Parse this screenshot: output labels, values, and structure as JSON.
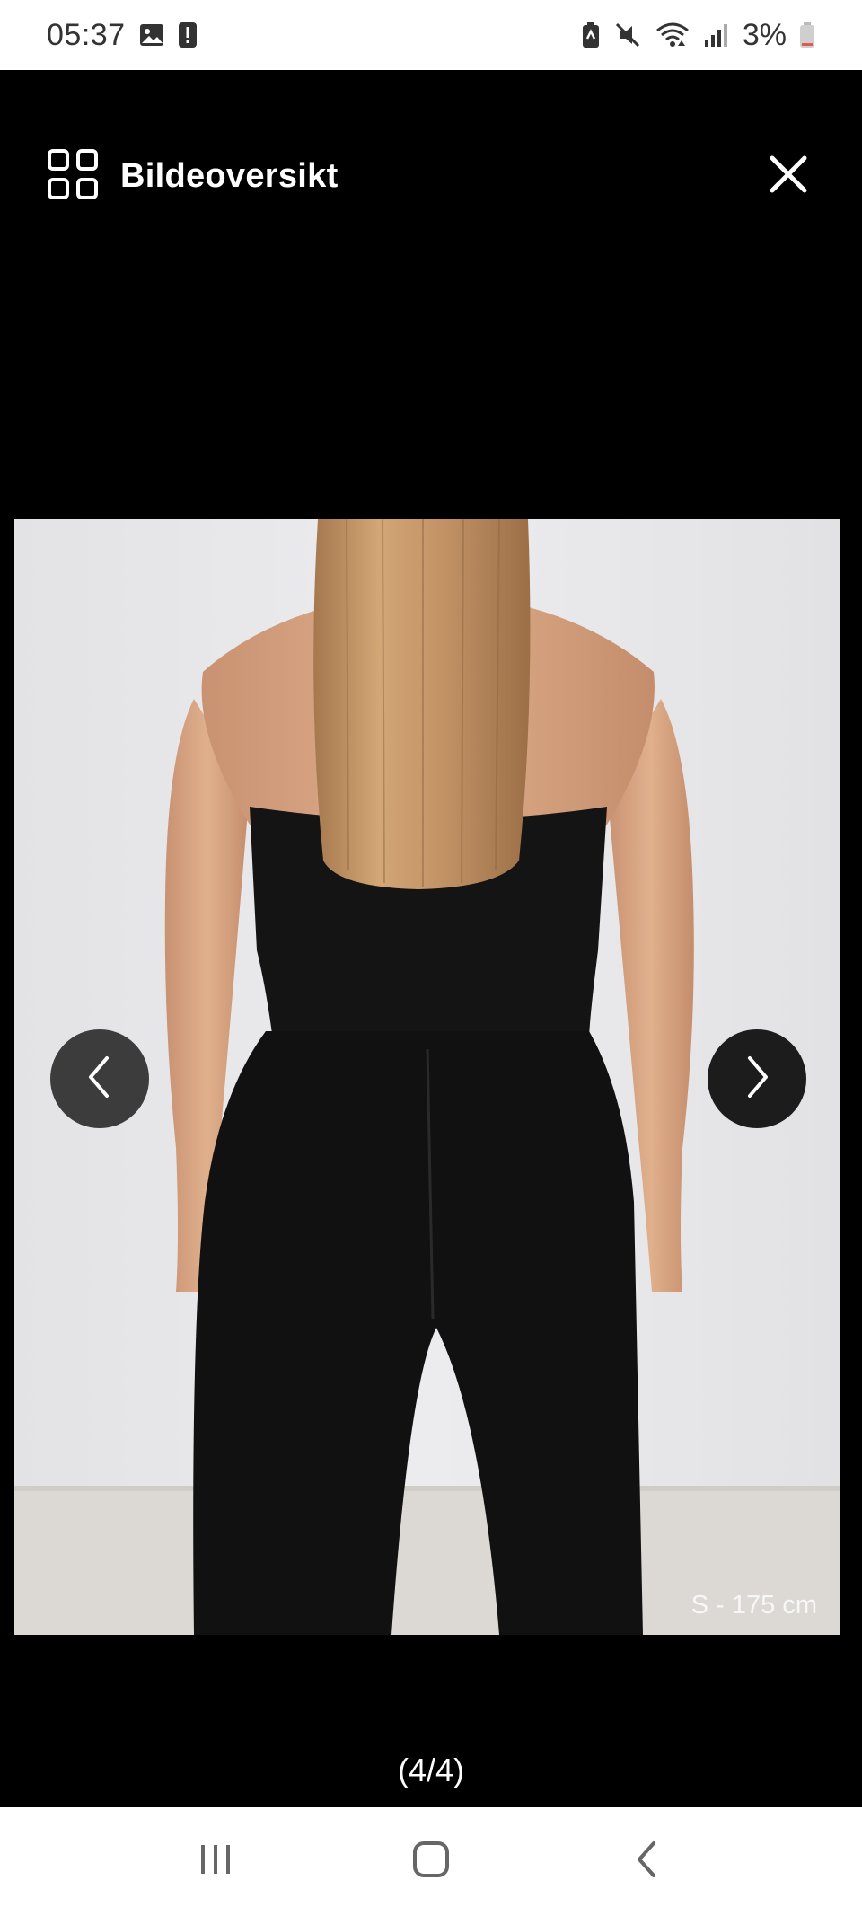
{
  "status_bar": {
    "time": "05:37",
    "battery": "3%",
    "icons": [
      "gallery-icon",
      "alert-icon",
      "battery-saver-icon",
      "mute-icon",
      "wifi-icon",
      "signal-icon",
      "battery-icon"
    ]
  },
  "header": {
    "overview_label": "Bildeoversikt",
    "overview_icon": "grid-icon",
    "close_icon": "close-icon"
  },
  "image": {
    "caption": "S - 175 cm"
  },
  "navigation": {
    "prev_icon": "chevron-left-icon",
    "next_icon": "chevron-right-icon"
  },
  "counter": "(4/4)",
  "android_nav": {
    "recents_icon": "recents-icon",
    "home_icon": "home-icon",
    "back_icon": "back-icon"
  },
  "colors": {
    "background": "#000000",
    "status_bar": "#ffffff",
    "photo_wall": "#e7e7e9",
    "garment": "#121212",
    "skin": "#d9a883",
    "hair": "#c99868"
  }
}
